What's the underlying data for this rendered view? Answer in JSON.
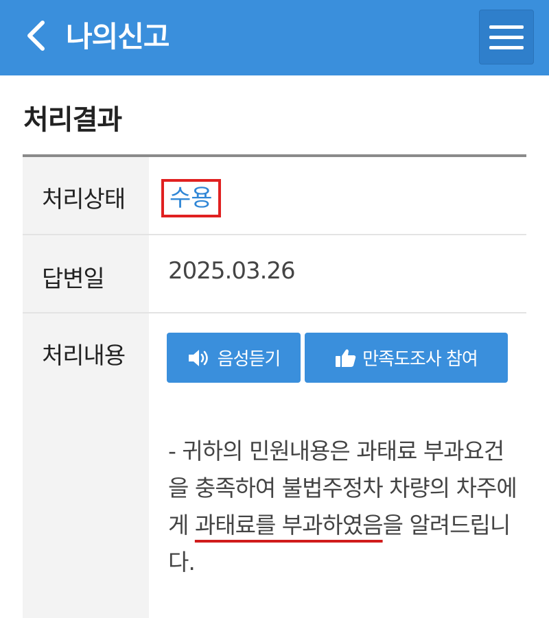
{
  "header": {
    "title": "나의신고"
  },
  "section": {
    "title": "처리결과"
  },
  "result": {
    "status_label": "처리상태",
    "status_value": "수용",
    "date_label": "답변일",
    "date_value": "2025.03.26",
    "content_label": "처리내용",
    "listen_button": "음성듣기",
    "survey_button": "만족도조사 참여",
    "content_text_before": "- 귀하의 민원내용은 과태료 부과요건을 충족하여 불법주정차 차량의 차주에게 ",
    "content_text_highlight": "과태료를 부과하였음",
    "content_text_after": "을 알려드립니다."
  },
  "colors": {
    "header_bg": "#3a8fdc",
    "accent": "#2f86d6",
    "highlight_red": "#e02020"
  },
  "icons": {
    "back": "chevron-left-icon",
    "menu": "hamburger-menu-icon",
    "speaker": "speaker-icon",
    "thumbs_up": "thumbs-up-icon"
  }
}
